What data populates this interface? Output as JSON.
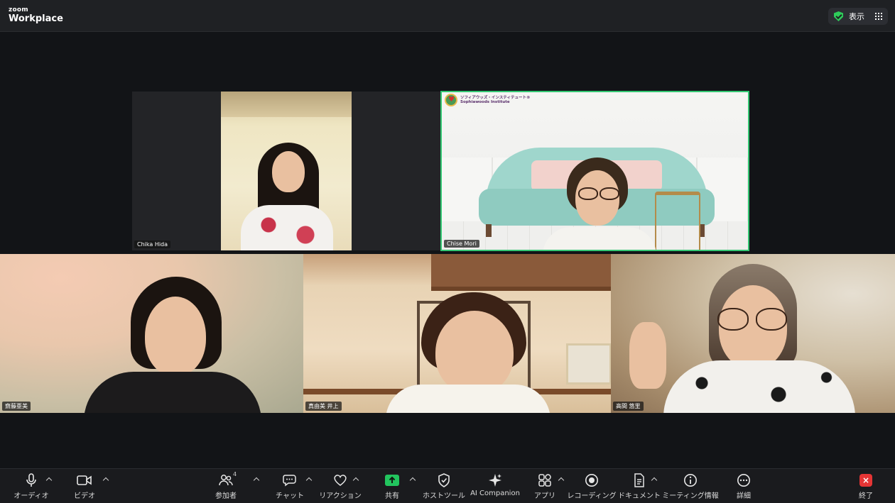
{
  "app": {
    "logo_small": "zoom",
    "logo_big": "Workplace",
    "view_label": "表示"
  },
  "participants": [
    {
      "name": "Chika Hida"
    },
    {
      "name": "Chise Mori",
      "brand_ja": "ソフィアウッズ・インスティテュート®",
      "brand_en": "Sophiawoods Institute"
    },
    {
      "name": "齋藤亜美"
    },
    {
      "name": "真由美 井上"
    },
    {
      "name": "高間 悠里"
    }
  ],
  "toolbar": {
    "audio": "オーディオ",
    "video": "ビデオ",
    "participants": "参加者",
    "participants_count": "4",
    "chat": "チャット",
    "reactions": "リアクション",
    "share": "共有",
    "host_tools": "ホストツール",
    "ai": "AI Companion",
    "apps": "アプリ",
    "recording": "レコーディング",
    "docs": "ドキュメント",
    "meeting_info": "ミーティング情報",
    "more": "詳細",
    "end": "終了"
  },
  "colors": {
    "active_speaker_border": "#33c773",
    "share_green": "#22c55e",
    "end_red": "#e53535"
  }
}
